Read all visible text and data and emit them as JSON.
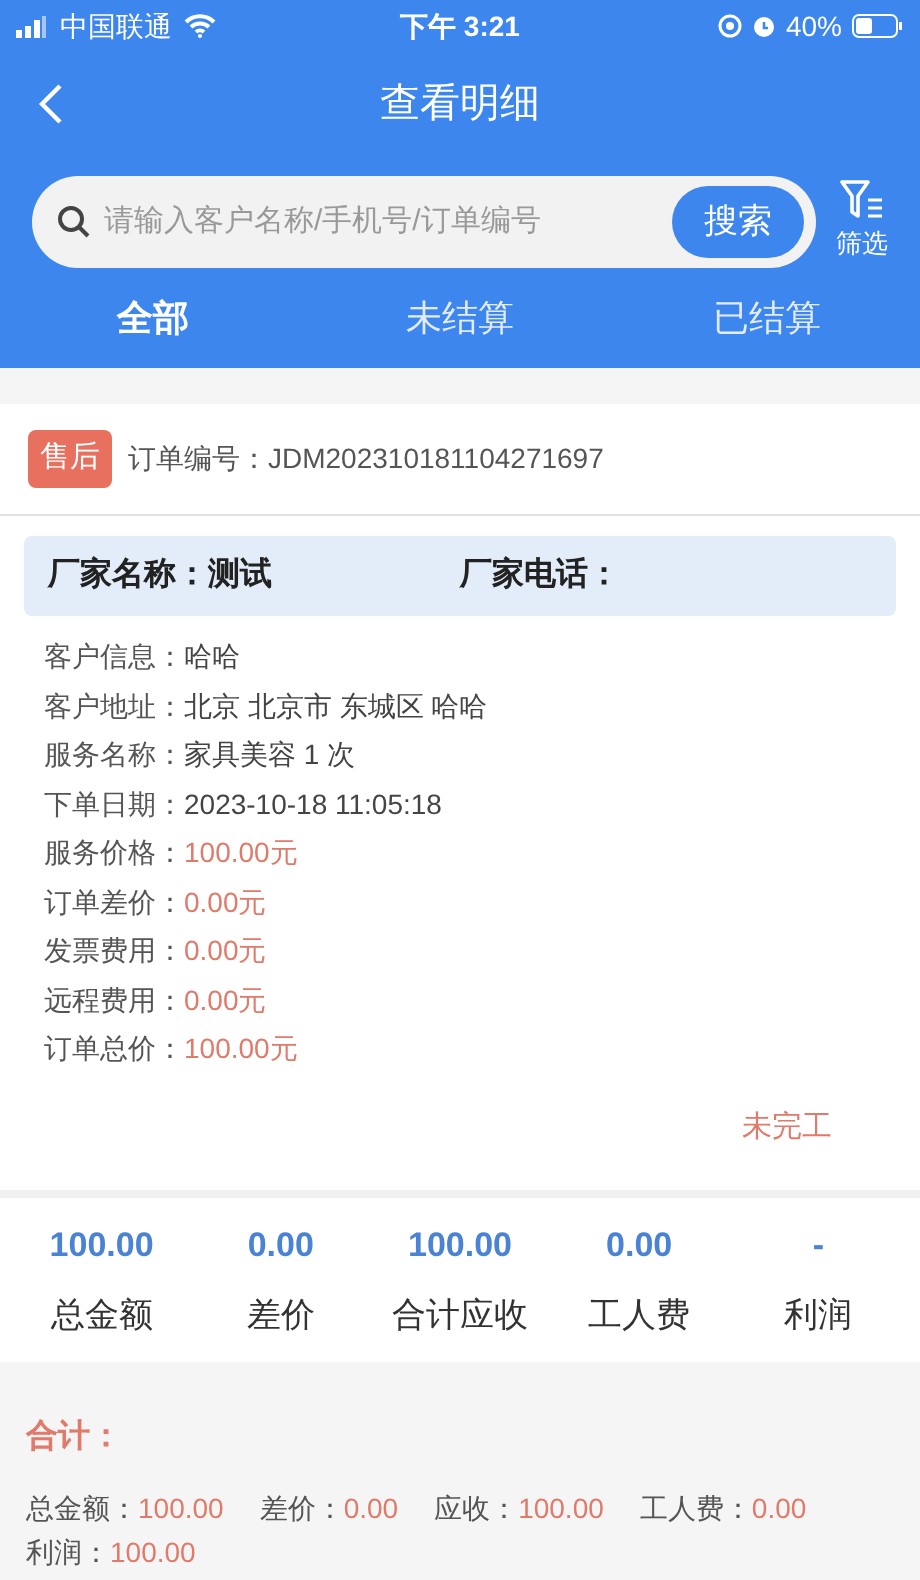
{
  "status_bar": {
    "carrier": "中国联通",
    "time": "下午 3:21",
    "battery": "40%"
  },
  "header": {
    "title": "查看明细"
  },
  "search": {
    "placeholder": "请输入客户名称/手机号/订单编号",
    "button": "搜索",
    "filter": "筛选"
  },
  "tabs": [
    {
      "label": "全部",
      "selected": true
    },
    {
      "label": "未结算",
      "selected": false
    },
    {
      "label": "已结算",
      "selected": false
    }
  ],
  "order": {
    "badge": "售后",
    "number": "订单编号：JDM202310181104271697",
    "vendor": [
      {
        "text": "厂家名称：测试"
      },
      {
        "text": "厂家电话："
      }
    ],
    "fields": [
      {
        "label": "客户信息：",
        "value": "哈哈",
        "kind": "plain"
      },
      {
        "label": "客户地址：",
        "value": "北京 北京市 东城区 哈哈",
        "kind": "plain"
      },
      {
        "label": "服务名称：",
        "value": "家具美容 1 次",
        "kind": "plain"
      },
      {
        "label": "下单日期：",
        "value": "2023-10-18 11:05:18",
        "kind": "plain"
      },
      {
        "label": "服务价格：",
        "value": "100.00元",
        "kind": "money"
      },
      {
        "label": "订单差价：",
        "value": "0.00元",
        "kind": "money"
      },
      {
        "label": "发票费用：",
        "value": "0.00元",
        "kind": "money"
      },
      {
        "label": "远程费用：",
        "value": "0.00元",
        "kind": "money"
      },
      {
        "label": "订单总价：",
        "value": "100.00元",
        "kind": "money"
      }
    ],
    "status": "未完工"
  },
  "stats": [
    {
      "value": "100.00",
      "label": "总金额"
    },
    {
      "value": "0.00",
      "label": "差价"
    },
    {
      "value": "100.00",
      "label": "合计应收"
    },
    {
      "value": "0.00",
      "label": "工人费"
    },
    {
      "value": "-",
      "label": "利润"
    }
  ],
  "total": {
    "title": "合计：",
    "items": [
      {
        "label": "总金额：",
        "value": "100.00"
      },
      {
        "label": "差价：",
        "value": "0.00"
      },
      {
        "label": "应收：",
        "value": "100.00"
      },
      {
        "label": "工人费：",
        "value": "0.00"
      },
      {
        "label": "利润：",
        "value": "100.00"
      }
    ]
  }
}
